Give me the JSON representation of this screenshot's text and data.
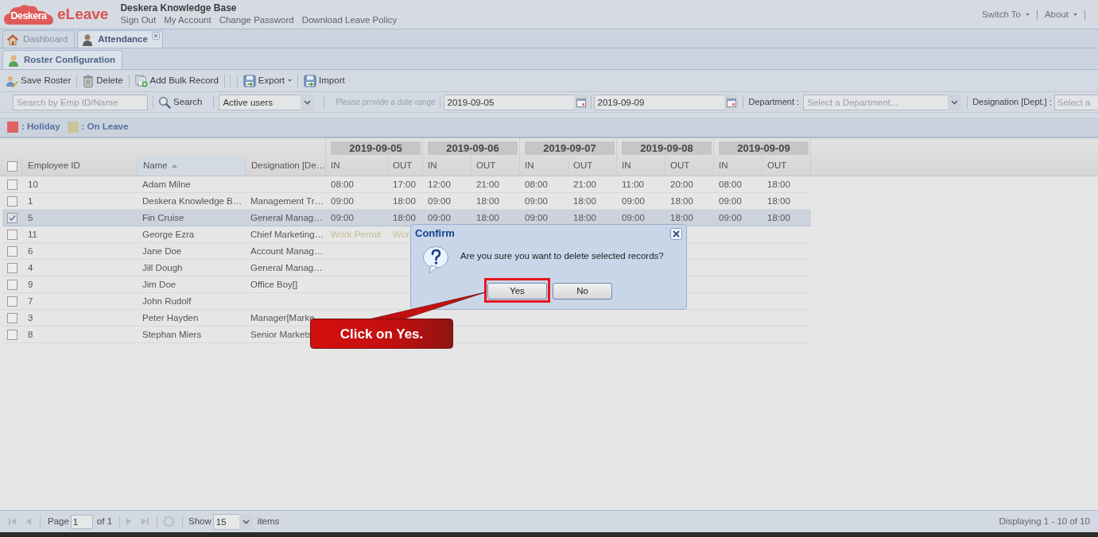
{
  "header": {
    "logo": {
      "brand": "Deskera",
      "product": "eLeave"
    },
    "title": "Deskera Knowledge Base",
    "links": [
      "Sign Out",
      "My Account",
      "Change Password",
      "Download Leave Policy"
    ],
    "menus": [
      "Switch To",
      "About"
    ]
  },
  "tabs": [
    {
      "label": "Dashboard",
      "kind": "home",
      "selected": false,
      "closable": false
    },
    {
      "label": "Attendance",
      "kind": "page",
      "selected": true,
      "closable": true
    }
  ],
  "subtabs": [
    {
      "label": "Roster Configuration",
      "selected": true
    }
  ],
  "toolbar": [
    {
      "label": "Save Roster",
      "kind": "save",
      "dropdown": false
    },
    {
      "label": "Delete",
      "kind": "delete",
      "dropdown": false
    },
    {
      "label": "Add Bulk Record",
      "kind": "bulk",
      "dropdown": false
    },
    {
      "label": "Export",
      "kind": "export",
      "dropdown": true
    },
    {
      "label": "Import",
      "kind": "import",
      "dropdown": false
    }
  ],
  "filters": {
    "search": {
      "placeholder": "Search by Emp ID/Name"
    },
    "search_button": "Search",
    "user_status": {
      "value": "Active users"
    },
    "date_hint": "Please provide a date range",
    "date_from": {
      "value": "2019-09-05"
    },
    "date_to": {
      "value": "2019-09-09"
    },
    "department": {
      "label": "Department :",
      "placeholder": "Select a Department..."
    },
    "designation": {
      "label": "Designation [Dept.] :",
      "placeholder": "Select a"
    }
  },
  "legend": [
    {
      "label": ": Holiday",
      "color": "#e06262"
    },
    {
      "label": ": On Leave",
      "color": "#c9c49b"
    }
  ],
  "grid": {
    "select_all": {
      "checked": false
    },
    "columns": [
      {
        "label": "Employee ID",
        "sorted": false
      },
      {
        "label": "Name",
        "sorted": true
      },
      {
        "label": "Designation [De…",
        "sorted": false
      }
    ],
    "dates": [
      {
        "label": "2019-09-05",
        "sub": [
          "IN",
          "OUT"
        ]
      },
      {
        "label": "2019-09-06",
        "sub": [
          "IN",
          "OUT"
        ]
      },
      {
        "label": "2019-09-07",
        "sub": [
          "IN",
          "OUT"
        ]
      },
      {
        "label": "2019-09-08",
        "sub": [
          "IN",
          "OUT"
        ]
      },
      {
        "label": "2019-09-09",
        "sub": [
          "IN",
          "OUT"
        ]
      }
    ],
    "rows": [
      {
        "id": "10",
        "name": "Adam Milne",
        "kind": "times",
        "selected": false,
        "cells": [
          "08:00",
          "17:00",
          "12:00",
          "21:00",
          "08:00",
          "21:00",
          "11:00",
          "20:00",
          "08:00",
          "18:00"
        ]
      },
      {
        "id": "1",
        "name": "Deskera Knowledge B…",
        "designation": "Management Tr…",
        "kind": "times",
        "selected": false,
        "cells": [
          "09:00",
          "18:00",
          "09:00",
          "18:00",
          "09:00",
          "18:00",
          "09:00",
          "18:00",
          "09:00",
          "18:00"
        ]
      },
      {
        "id": "5",
        "name": "Fin Cruise",
        "designation": "General Manag…",
        "kind": "times",
        "selected": true,
        "cells": [
          "09:00",
          "18:00",
          "09:00",
          "18:00",
          "09:00",
          "18:00",
          "09:00",
          "18:00",
          "09:00",
          "18:00"
        ]
      },
      {
        "id": "11",
        "name": "George Ezra",
        "designation": "Chief Marketing…",
        "kind": "leave",
        "selected": false,
        "cells": [
          "Work Permit",
          "Wor"
        ]
      },
      {
        "id": "6",
        "name": "Jane Doe",
        "designation": "Account Manag…",
        "kind": "times",
        "selected": false
      },
      {
        "id": "4",
        "name": "Jill Dough",
        "designation": "General Manag…",
        "kind": "times",
        "selected": false
      },
      {
        "id": "9",
        "name": "Jim Doe",
        "designation": "Office Boy[]",
        "kind": "times",
        "selected": false
      },
      {
        "id": "7",
        "name": "John Rudolf",
        "kind": "times",
        "selected": false
      },
      {
        "id": "3",
        "name": "Peter Hayden",
        "designation": "Manager[Marke",
        "kind": "times",
        "selected": false
      },
      {
        "id": "8",
        "name": "Stephan Miers",
        "designation": "Senior Markets",
        "kind": "times",
        "selected": false
      }
    ]
  },
  "pager": {
    "back": [
      {
        "kind": "first",
        "disabled": true
      },
      {
        "kind": "prev",
        "disabled": true
      }
    ],
    "page_label": "Page",
    "page": "1",
    "of_label": "of 1",
    "forward": [
      {
        "kind": "next",
        "disabled": true
      },
      {
        "kind": "last",
        "disabled": true
      }
    ],
    "show_label": "Show",
    "page_size": "15",
    "items_label": "items",
    "summary": "Displaying 1 - 10 of 10"
  },
  "dialog": {
    "title": "Confirm",
    "message": "Are you sure you want to delete selected records?",
    "buttons": [
      {
        "label": "Yes",
        "highlighted": true
      },
      {
        "label": "No",
        "highlighted": false
      }
    ]
  },
  "callout": {
    "text": "Click on Yes."
  }
}
